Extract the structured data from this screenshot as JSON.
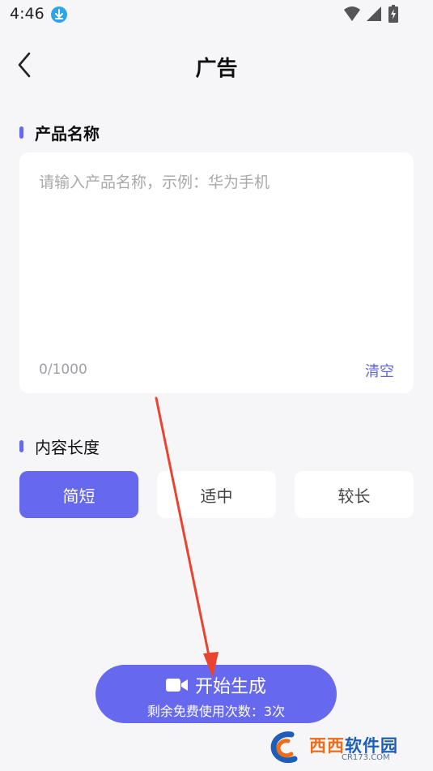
{
  "status_bar": {
    "time": "4:46",
    "icons": [
      "download-icon",
      "wifi-icon",
      "signal-icon",
      "battery-icon"
    ]
  },
  "header": {
    "back_icon": "chevron-left-icon",
    "title": "广告"
  },
  "product_section": {
    "title": "产品名称",
    "input_value": "",
    "input_placeholder": "请输入产品名称，示例：华为手机",
    "counter": "0/1000",
    "clear_label": "清空"
  },
  "length_section": {
    "title": "内容长度",
    "options": [
      {
        "label": "简短",
        "selected": true
      },
      {
        "label": "适中",
        "selected": false
      },
      {
        "label": "较长",
        "selected": false
      }
    ]
  },
  "generate": {
    "icon": "video-camera-icon",
    "label": "开始生成",
    "remaining_text": "剩余免费使用次数：3次"
  },
  "watermark": {
    "text_part1": "西西",
    "text_part2": "软件园",
    "domain": "CR173.COM"
  },
  "colors": {
    "accent": "#6668ee",
    "background": "#f6f6f9",
    "card": "#ffffff",
    "link": "#6366d8",
    "annotation": "#e8442f"
  }
}
